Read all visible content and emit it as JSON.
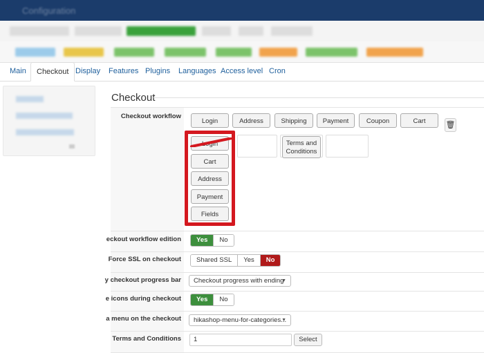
{
  "header": {
    "title": "Configuration"
  },
  "tabs": [
    {
      "label": "Main"
    },
    {
      "label": "Checkout",
      "active": true
    },
    {
      "label": "Display"
    },
    {
      "label": "Features"
    },
    {
      "label": "Plugins"
    },
    {
      "label": "Languages"
    },
    {
      "label": "Access level"
    },
    {
      "label": "Cron"
    }
  ],
  "section": {
    "title": "Checkout"
  },
  "workflow": {
    "label": "Checkout workflow",
    "steps": [
      "Login",
      "Address",
      "Shipping",
      "Payment",
      "Coupon",
      "Cart"
    ],
    "block1": [
      "Login",
      "Cart",
      "Address",
      "Payment",
      "Fields"
    ],
    "terms_block": "Terms and Conditions"
  },
  "rows": {
    "workflow_edition": {
      "label": "eckout workflow edition",
      "options": [
        "Yes",
        "No"
      ],
      "selected": "Yes"
    },
    "force_ssl": {
      "label": "Force SSL on checkout",
      "options": [
        "Shared SSL",
        "Yes",
        "No"
      ],
      "selected": "No"
    },
    "progress_bar": {
      "label": "y checkout progress bar",
      "value": "Checkout progress with ending"
    },
    "icons": {
      "label": "e icons during checkout",
      "options": [
        "Yes",
        "No"
      ],
      "selected": "Yes"
    },
    "menu": {
      "label": "a menu on the checkout",
      "value": "hikashop-menu-for-categories..."
    },
    "terms": {
      "label": "Terms and Conditions",
      "value": "1",
      "button": "Select"
    }
  },
  "colors": {
    "topbar": "#1b3c6b",
    "highlight": "#d4181f",
    "yes_green": "#3d8f3d",
    "no_red": "#b01a1a",
    "link": "#1e5f9c"
  },
  "icons": {
    "delete": "trash-icon"
  }
}
